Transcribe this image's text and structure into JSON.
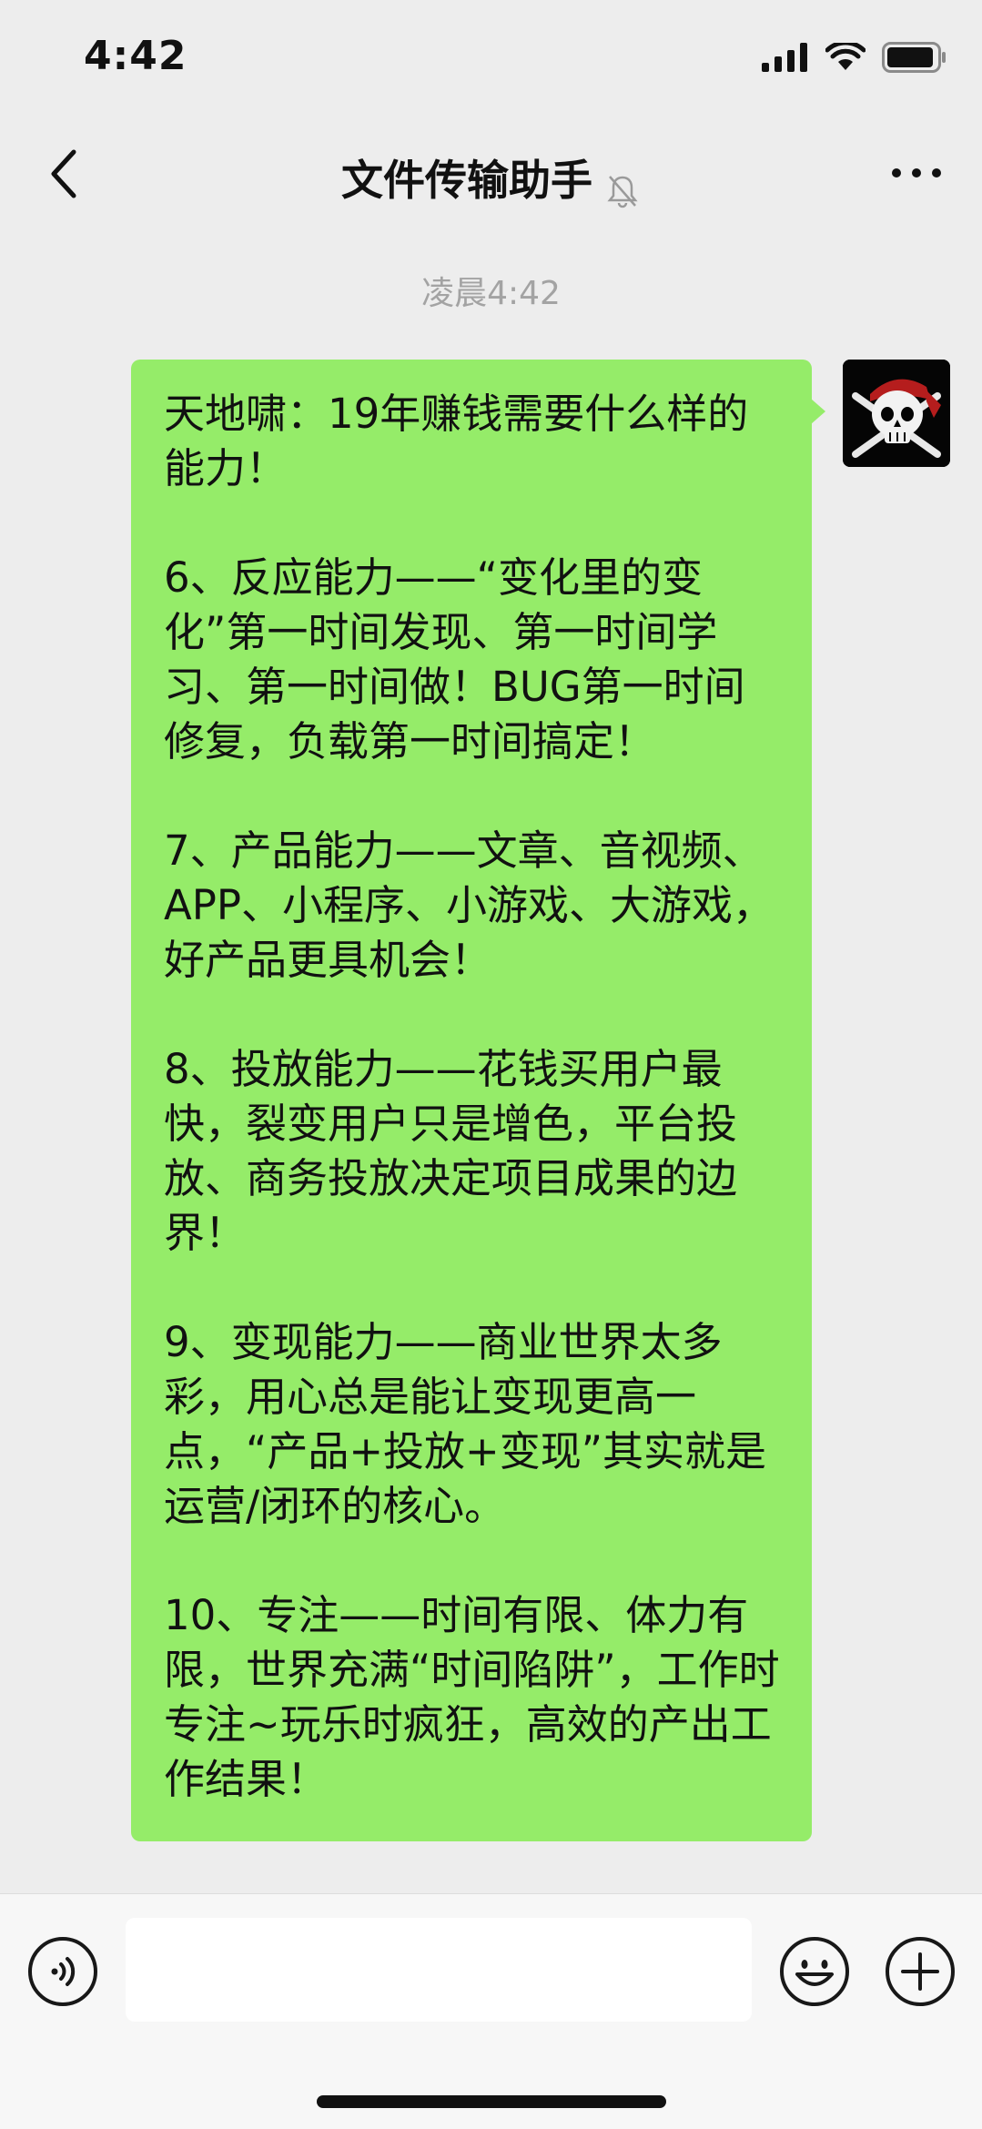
{
  "status_bar": {
    "time": "4:42"
  },
  "nav": {
    "title": "文件传输助手"
  },
  "chat": {
    "timestamp": "凌晨4:42",
    "message": {
      "paragraphs": [
        "天地啸：19年赚钱需要什么样的能力！",
        "6、反应能力——“变化里的变化”第一时间发现、第一时间学习、第一时间做！BUG第一时间修复，负载第一时间搞定！",
        "7、产品能力——文章、音视频、APP、小程序、小游戏、大游戏，好产品更具机会！",
        "8、投放能力——花钱买用户最快，裂变用户只是增色，平台投放、商务投放决定项目成果的边界！",
        "9、变现能力——商业世界太多彩，用心总是能让变现更高一点，“产品+投放+变现”其实就是运营/闭环的核心。",
        "10、专注——时间有限、体力有限，世界充满“时间陷阱”，工作时专注~玩乐时疯狂，高效的产出工作结果！"
      ]
    }
  },
  "input_bar": {
    "value": ""
  },
  "colors": {
    "bubble": "#95ec69",
    "background": "#ededed"
  }
}
